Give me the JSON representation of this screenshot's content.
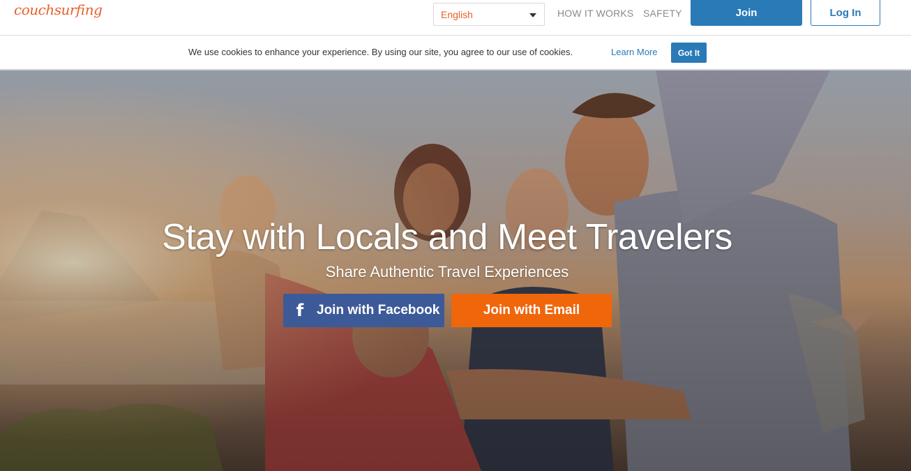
{
  "header": {
    "logo": "couchsurfing",
    "language": "English",
    "nav": {
      "how_it_works": "HOW IT WORKS",
      "safety": "SAFETY"
    },
    "join_label": "Join",
    "login_label": "Log In"
  },
  "cookie_bar": {
    "message": "We use cookies to enhance your experience. By using our site, you agree to our use of cookies.",
    "learn_more": "Learn More",
    "got_it": "Got It"
  },
  "hero": {
    "title": "Stay with Locals and Meet Travelers",
    "subtitle": "Share Authentic Travel Experiences",
    "facebook_button": "Join with Facebook",
    "email_button": "Join with Email",
    "facebook_icon": "facebook-icon"
  },
  "colors": {
    "brand_orange": "#e8602c",
    "primary_blue": "#2a7ab8",
    "facebook_blue": "#3d5a98",
    "email_orange": "#f0660a"
  }
}
